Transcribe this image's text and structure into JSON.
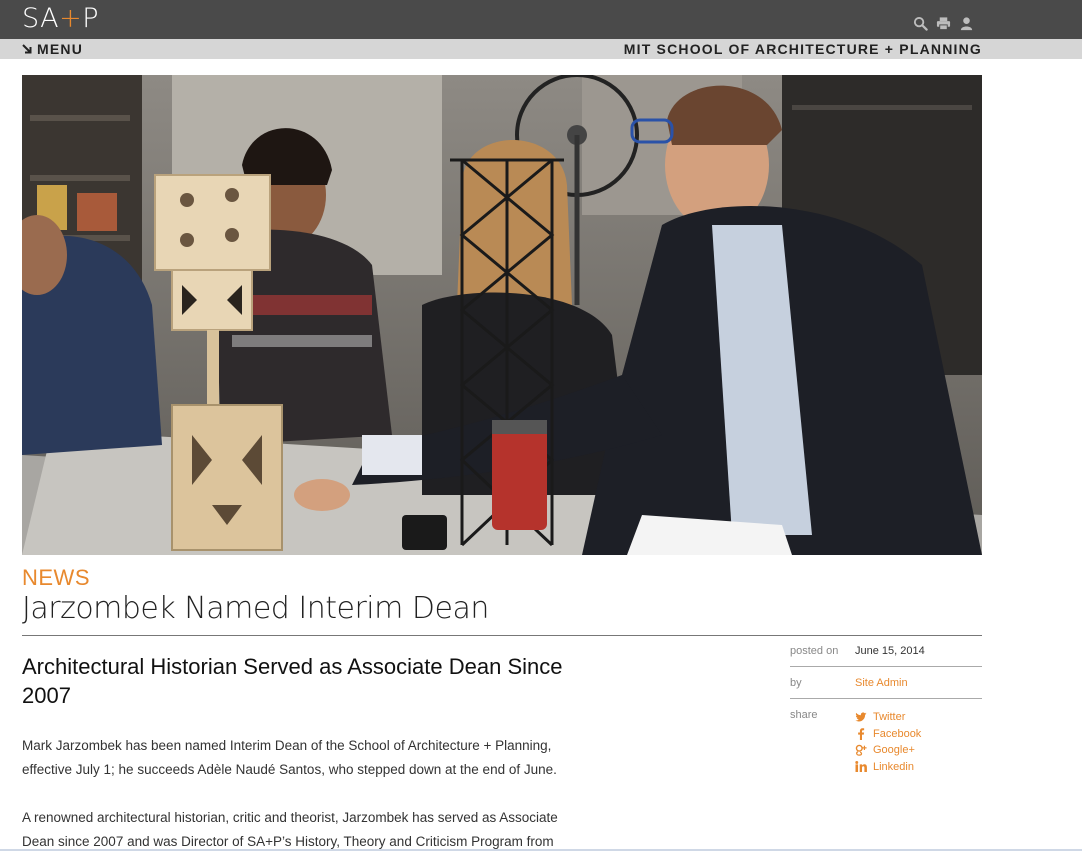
{
  "header": {
    "logo_prefix": "SA",
    "logo_plus": "+",
    "logo_suffix": "P",
    "icons": [
      "search-icon",
      "print-icon",
      "user-icon"
    ]
  },
  "menubar": {
    "menu_label": "MENU",
    "school_label": "MIT SCHOOL OF ARCHITECTURE + PLANNING"
  },
  "article": {
    "section": "NEWS",
    "title": "Jarzombek Named Interim Dean",
    "subtitle": "Architectural Historian Served as Associate Dean Since 2007",
    "paragraphs": [
      "Mark Jarzombek has been named Interim Dean of the School of Architecture + Planning, effective July 1; he succeeds Adèle Naudé Santos, who stepped down at the end of June.",
      "A renowned architectural historian, critic and theorist, Jarzombek has served as Associate Dean since 2007 and was Director of SA+P’s History, Theory and Criticism Program from"
    ]
  },
  "meta": {
    "posted_label": "posted on",
    "posted_value": "June 15, 2014",
    "by_label": "by",
    "by_value": "Site Admin",
    "share_label": "share",
    "share": [
      {
        "icon": "twitter-icon",
        "label": "Twitter"
      },
      {
        "icon": "facebook-icon",
        "label": "Facebook"
      },
      {
        "icon": "google-plus-icon",
        "label": "Google+"
      },
      {
        "icon": "linkedin-icon",
        "label": "Linkedin"
      }
    ]
  },
  "colors": {
    "accent": "#e8892e",
    "topbar": "#4a4a4a",
    "menubar": "#d6d6d6"
  }
}
